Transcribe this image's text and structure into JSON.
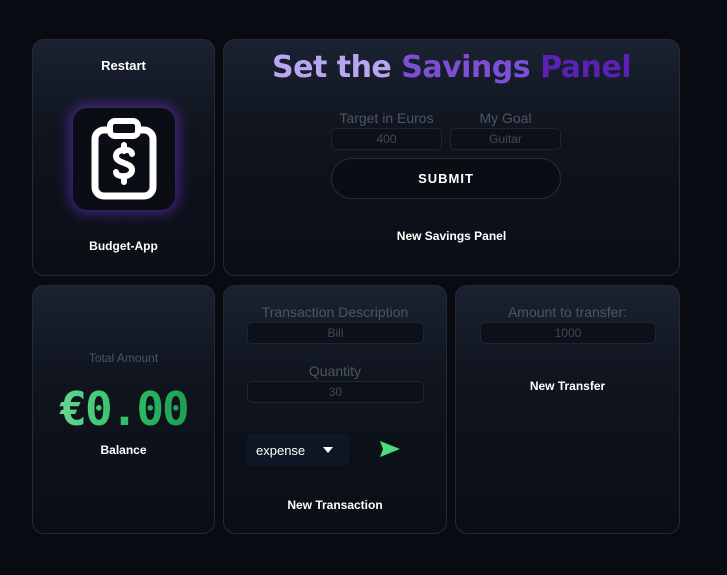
{
  "app_card": {
    "restart_label": "Restart",
    "icon": "clipboard-dollar-icon",
    "app_name": "Budget-App"
  },
  "savings": {
    "title_part1": "Set the ",
    "title_part2": "Savings ",
    "title_part3": "Panel",
    "target_label": "Target in Euros",
    "target_value": "400",
    "goal_label": "My Goal",
    "goal_value": "Guitar",
    "submit_label": "SUBMIT",
    "caption": "New Savings Panel"
  },
  "balance": {
    "total_label": "Total Amount",
    "amount": "€0.00",
    "caption": "Balance"
  },
  "transaction": {
    "description_label": "Transaction Description",
    "description_value": "Bill",
    "quantity_label": "Quantity",
    "quantity_value": "30",
    "type_selected": "expense",
    "send_icon": "send-arrow-icon",
    "caption": "New Transaction"
  },
  "transfer": {
    "amount_label": "Amount to transfer:",
    "amount_value": "1000",
    "caption": "New Transfer"
  },
  "colors": {
    "background": "#080c12",
    "accent_purple": "#7c3aed",
    "balance_green": "#2fbf6a",
    "send_green": "#4ade80"
  }
}
